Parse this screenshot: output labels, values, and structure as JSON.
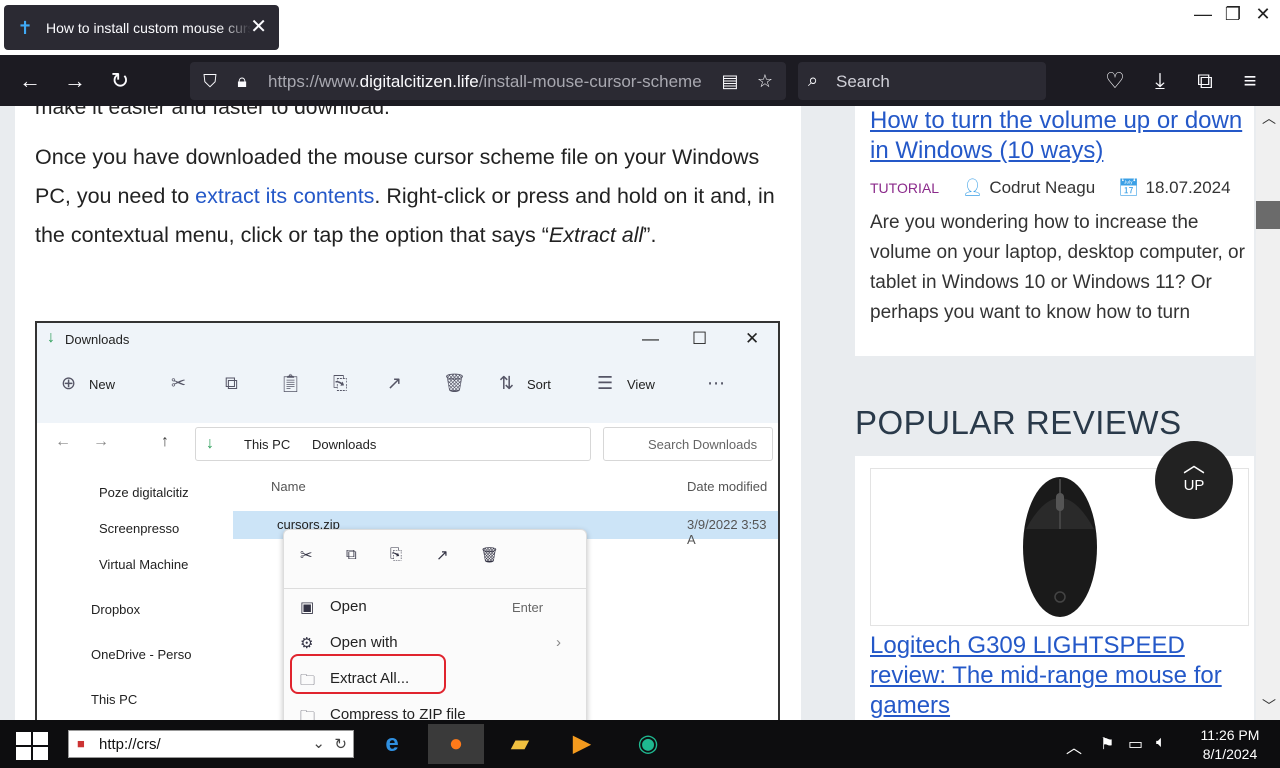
{
  "tab": {
    "title": "How to install custom mouse cursor schemes"
  },
  "window_controls": {
    "minimize": "—",
    "restore": "❐",
    "close": "✕"
  },
  "urlbar": {
    "prefix": "https://www.",
    "host": "digitalcitizen.life",
    "path": "/install-mouse-cursor-scheme"
  },
  "search": {
    "placeholder": "Search"
  },
  "article": {
    "cut_line": "make it easier and faster to download.",
    "para_1": "Once you have downloaded the mouse cursor scheme file on your Windows PC, you need to ",
    "para_link": "extract its contents",
    "para_2": ". Right-click or press and hold on it and, in the contextual menu, click or tap the option that says “",
    "para_em": "Extract all",
    "para_3": "”."
  },
  "explorer": {
    "title": "Downloads",
    "toolbar": {
      "new": "New",
      "sort": "Sort",
      "view": "View"
    },
    "breadcrumb": {
      "this_pc": "This PC",
      "downloads": "Downloads"
    },
    "search_placeholder": "Search Downloads",
    "sidebar": [
      "Poze digitalcitiz",
      "Screenpresso",
      "Virtual Machine",
      "Dropbox",
      "OneDrive - Perso",
      "This PC"
    ],
    "columns": {
      "name": "Name",
      "date": "Date modified"
    },
    "file": {
      "name": "cursors.zip",
      "date": "3/9/2022 3:53 A"
    },
    "context_menu": [
      {
        "label": "Open",
        "shortcut": "Enter"
      },
      {
        "label": "Open with",
        "shortcut": ""
      },
      {
        "label": "Extract All...",
        "shortcut": ""
      },
      {
        "label": "Compress to ZIP file",
        "shortcut": ""
      }
    ]
  },
  "sidebar": {
    "card1": {
      "title": "How to turn the volume up or down in Windows (10 ways)",
      "tag": "TUTORIAL",
      "author": "Codrut Neagu",
      "date": "18.07.2024",
      "excerpt": "Are you wondering how to increase the volume on your laptop, desktop computer, or tablet in Windows 10 or Windows 11? Or perhaps you want to know how to turn"
    },
    "popular_heading": "POPULAR REVIEWS",
    "card2": {
      "title": "Logitech G309 LIGHTSPEED review: The mid-range mouse for gamers"
    },
    "up_label": "UP"
  },
  "taskbar": {
    "address": "http://crs/",
    "time": "11:26 PM",
    "date": "8/1/2024"
  }
}
